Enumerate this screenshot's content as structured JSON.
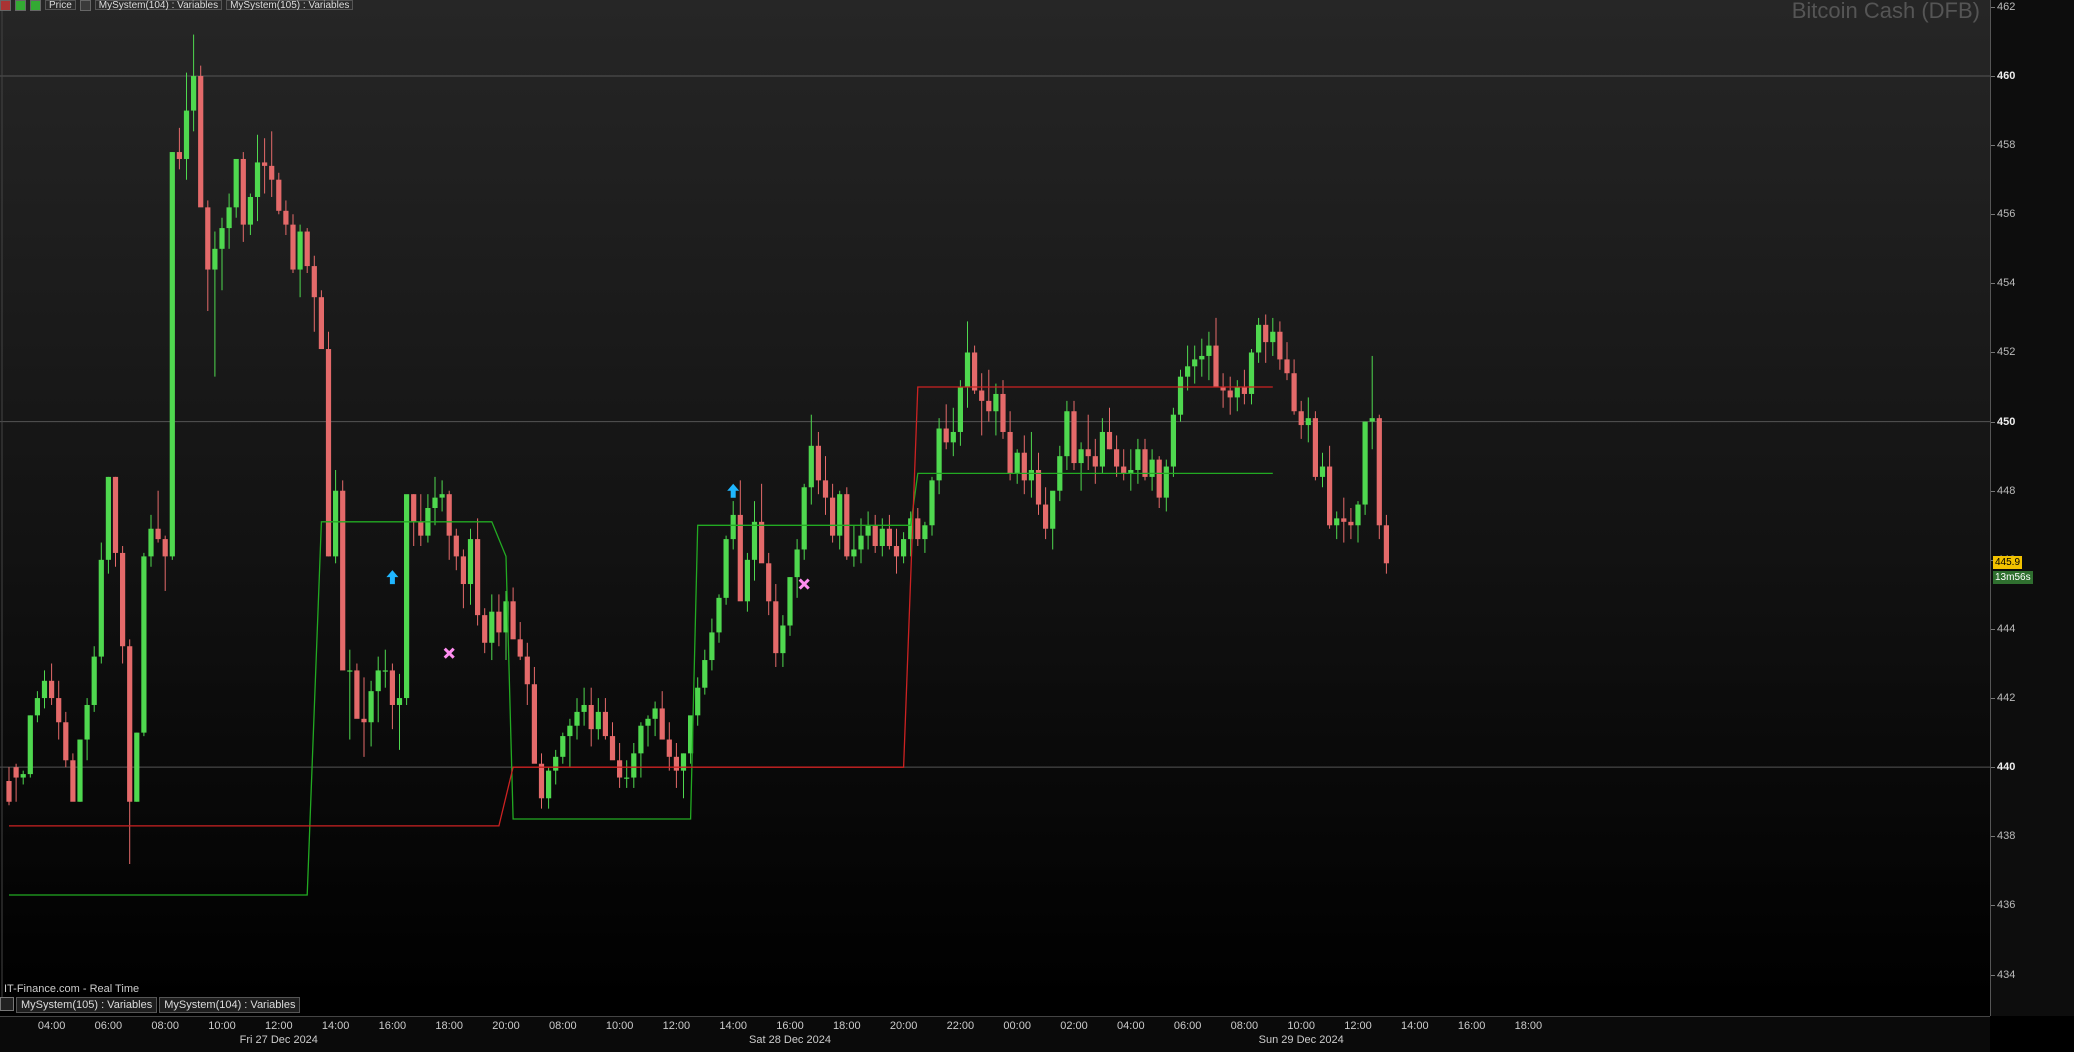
{
  "toolbar": {
    "price_label": "Price",
    "indicator_1": "MySystem(104) : Variables",
    "indicator_2": "MySystem(105) : Variables"
  },
  "watermark": "Bitcoin Cash (DFB)",
  "source": "IT-Finance.com - Real Time",
  "panels": [
    "MySystem(105) : Variables",
    "MySystem(104) : Variables"
  ],
  "badges": {
    "last_price": "445.9",
    "timer": "13m56s"
  },
  "colors": {
    "up": "#4fd84f",
    "down": "#e46a6a",
    "support": "#22aa22",
    "resistance": "#cc2222",
    "buy_arrow": "#1fb6ff",
    "exit_mark": "#ff8ef0"
  },
  "chart_data": {
    "type": "candlestick",
    "title": "Bitcoin Cash (DFB)",
    "ylim": [
      432.8,
      462.2
    ],
    "y_ticks": [
      462,
      460,
      458,
      456,
      454,
      452,
      450,
      448,
      446,
      444,
      442,
      440,
      438,
      436,
      434
    ],
    "major_y": [
      460,
      450,
      440
    ],
    "x_ticks": [
      {
        "label": "04:00",
        "i": 6
      },
      {
        "label": "06:00",
        "i": 14
      },
      {
        "label": "08:00",
        "i": 22
      },
      {
        "label": "10:00",
        "i": 30
      },
      {
        "label": "12:00",
        "i": 38
      },
      {
        "label": "14:00",
        "i": 46
      },
      {
        "label": "16:00",
        "i": 54
      },
      {
        "label": "18:00",
        "i": 62
      },
      {
        "label": "20:00",
        "i": 70
      },
      {
        "label": "08:00",
        "i": 78
      },
      {
        "label": "10:00",
        "i": 86
      },
      {
        "label": "12:00",
        "i": 94
      },
      {
        "label": "14:00",
        "i": 102
      },
      {
        "label": "16:00",
        "i": 110
      },
      {
        "label": "18:00",
        "i": 118
      },
      {
        "label": "20:00",
        "i": 126
      },
      {
        "label": "22:00",
        "i": 134
      },
      {
        "label": "00:00",
        "i": 142
      },
      {
        "label": "02:00",
        "i": 150
      },
      {
        "label": "04:00",
        "i": 158
      },
      {
        "label": "06:00",
        "i": 166
      },
      {
        "label": "08:00",
        "i": 174
      },
      {
        "label": "10:00",
        "i": 182
      },
      {
        "label": "12:00",
        "i": 190
      },
      {
        "label": "14:00",
        "i": 198
      },
      {
        "label": "16:00",
        "i": 206
      },
      {
        "label": "18:00",
        "i": 214
      }
    ],
    "date_labels": [
      {
        "label": "Fri 27 Dec 2024",
        "i": 38
      },
      {
        "label": "Sat 28 Dec 2024",
        "i": 110
      },
      {
        "label": "Sun 29 Dec 2024",
        "i": 182
      }
    ],
    "candles": [
      [
        439.6,
        440.0,
        438.9,
        439.0
      ],
      [
        440.0,
        440.1,
        439.0,
        439.7
      ],
      [
        439.7,
        439.9,
        439.5,
        439.8
      ],
      [
        439.8,
        441.5,
        439.7,
        441.5
      ],
      [
        441.5,
        442.2,
        441.3,
        442.0
      ],
      [
        442.0,
        442.8,
        441.7,
        442.5
      ],
      [
        442.5,
        443.0,
        441.8,
        442.0
      ],
      [
        442.0,
        442.5,
        440.8,
        441.3
      ],
      [
        441.3,
        441.6,
        440.0,
        440.2
      ],
      [
        440.2,
        440.4,
        439.1,
        439.0
      ],
      [
        439.0,
        440.8,
        439.0,
        440.8
      ],
      [
        440.8,
        442.0,
        440.2,
        441.8
      ],
      [
        441.8,
        443.5,
        441.6,
        443.2
      ],
      [
        443.2,
        446.5,
        443.0,
        446.0
      ],
      [
        446.0,
        448.4,
        445.6,
        448.4
      ],
      [
        448.4,
        448.4,
        445.8,
        446.2
      ],
      [
        446.2,
        446.4,
        443.0,
        443.5
      ],
      [
        443.5,
        443.7,
        437.2,
        439.0
      ],
      [
        439.0,
        441.0,
        439.0,
        441.0
      ],
      [
        441.0,
        446.2,
        440.9,
        446.1
      ],
      [
        446.1,
        447.3,
        445.8,
        446.9
      ],
      [
        446.9,
        448.0,
        446.5,
        446.6
      ],
      [
        446.6,
        446.7,
        445.1,
        446.1
      ],
      [
        446.1,
        457.8,
        446.0,
        457.8
      ],
      [
        457.8,
        458.5,
        457.3,
        457.6
      ],
      [
        457.6,
        460.1,
        457.0,
        459.0
      ],
      [
        459.0,
        461.2,
        458.4,
        460.0
      ],
      [
        460.0,
        460.3,
        456.3,
        456.2
      ],
      [
        456.2,
        456.4,
        453.2,
        454.4
      ],
      [
        454.4,
        455.5,
        451.3,
        455.0
      ],
      [
        455.0,
        455.9,
        453.8,
        455.6
      ],
      [
        455.6,
        456.6,
        455.0,
        456.2
      ],
      [
        456.2,
        457.3,
        455.9,
        457.6
      ],
      [
        457.6,
        457.8,
        455.2,
        455.7
      ],
      [
        455.7,
        456.6,
        455.4,
        456.5
      ],
      [
        456.5,
        458.3,
        455.8,
        457.5
      ],
      [
        457.5,
        458.2,
        456.6,
        457.4
      ],
      [
        457.4,
        458.4,
        456.5,
        457.0
      ],
      [
        457.0,
        457.2,
        456.0,
        456.1
      ],
      [
        456.1,
        456.4,
        455.4,
        455.7
      ],
      [
        455.7,
        456.0,
        454.3,
        454.4
      ],
      [
        454.4,
        455.7,
        453.6,
        455.5
      ],
      [
        455.5,
        455.6,
        454.3,
        454.5
      ],
      [
        454.5,
        454.8,
        452.6,
        453.6
      ],
      [
        453.6,
        453.8,
        452.3,
        452.1
      ],
      [
        452.1,
        452.6,
        446.1,
        446.1
      ],
      [
        446.1,
        448.6,
        445.9,
        448.0
      ],
      [
        448.0,
        448.3,
        443.7,
        442.8
      ],
      [
        442.8,
        443.4,
        440.8,
        442.8
      ],
      [
        442.8,
        443.0,
        441.5,
        441.4
      ],
      [
        441.4,
        442.6,
        440.3,
        441.3
      ],
      [
        441.3,
        442.5,
        440.6,
        442.2
      ],
      [
        442.2,
        443.2,
        441.3,
        442.8
      ],
      [
        442.8,
        443.4,
        442.3,
        442.8
      ],
      [
        442.8,
        443.0,
        441.1,
        441.8
      ],
      [
        441.8,
        442.7,
        440.5,
        442.0
      ],
      [
        442.0,
        447.2,
        441.8,
        447.9
      ],
      [
        447.9,
        447.9,
        446.4,
        447.1
      ],
      [
        447.1,
        447.9,
        446.4,
        446.7
      ],
      [
        446.7,
        447.9,
        446.5,
        447.5
      ],
      [
        447.5,
        448.4,
        447.0,
        447.8
      ],
      [
        447.8,
        448.3,
        447.4,
        447.9
      ],
      [
        447.9,
        448.0,
        446.0,
        446.7
      ],
      [
        446.7,
        446.9,
        445.7,
        446.1
      ],
      [
        446.1,
        446.3,
        444.6,
        445.3
      ],
      [
        445.3,
        446.9,
        444.7,
        446.6
      ],
      [
        446.6,
        447.2,
        444.1,
        444.4
      ],
      [
        444.4,
        444.6,
        443.3,
        443.6
      ],
      [
        443.6,
        445.0,
        443.1,
        444.5
      ],
      [
        444.5,
        445.0,
        443.5,
        443.9
      ],
      [
        443.9,
        445.1,
        443.1,
        444.8
      ],
      [
        444.8,
        445.2,
        443.9,
        443.7
      ],
      [
        443.7,
        444.2,
        443.1,
        443.2
      ],
      [
        443.2,
        443.6,
        441.8,
        442.4
      ],
      [
        442.4,
        442.9,
        440.2,
        440.1
      ],
      [
        440.1,
        440.4,
        438.8,
        439.1
      ],
      [
        439.1,
        440.0,
        438.8,
        439.9
      ],
      [
        439.9,
        440.5,
        439.5,
        440.3
      ],
      [
        440.3,
        441.0,
        440.1,
        440.9
      ],
      [
        440.9,
        441.4,
        440.0,
        441.2
      ],
      [
        441.2,
        442.0,
        440.8,
        441.6
      ],
      [
        441.6,
        442.3,
        441.2,
        441.8
      ],
      [
        441.8,
        442.3,
        440.6,
        441.1
      ],
      [
        441.1,
        442.0,
        440.8,
        441.6
      ],
      [
        441.6,
        442.0,
        440.8,
        440.9
      ],
      [
        440.9,
        441.3,
        440.6,
        440.2
      ],
      [
        440.2,
        440.7,
        439.4,
        439.7
      ],
      [
        439.7,
        440.2,
        439.4,
        439.7
      ],
      [
        439.7,
        440.7,
        439.4,
        440.4
      ],
      [
        440.4,
        441.3,
        439.7,
        441.2
      ],
      [
        441.2,
        441.5,
        440.6,
        441.4
      ],
      [
        441.4,
        441.9,
        440.9,
        441.7
      ],
      [
        441.7,
        442.2,
        440.9,
        440.8
      ],
      [
        440.8,
        441.3,
        439.9,
        440.3
      ],
      [
        440.3,
        440.7,
        439.4,
        439.9
      ],
      [
        439.9,
        440.4,
        439.1,
        440.4
      ],
      [
        440.4,
        441.3,
        440.1,
        441.5
      ],
      [
        441.5,
        442.6,
        441.2,
        442.3
      ],
      [
        442.3,
        443.4,
        442.1,
        443.1
      ],
      [
        443.1,
        444.3,
        442.8,
        443.9
      ],
      [
        443.9,
        445.0,
        443.6,
        444.9
      ],
      [
        444.9,
        446.7,
        444.7,
        446.6
      ],
      [
        446.6,
        447.7,
        446.3,
        447.3
      ],
      [
        447.3,
        448.3,
        444.9,
        444.8
      ],
      [
        444.8,
        446.2,
        444.5,
        446.0
      ],
      [
        446.0,
        447.7,
        445.4,
        447.1
      ],
      [
        447.1,
        448.2,
        446.6,
        445.9
      ],
      [
        445.9,
        446.2,
        444.4,
        444.8
      ],
      [
        444.8,
        445.3,
        442.9,
        443.3
      ],
      [
        443.3,
        444.4,
        442.9,
        444.1
      ],
      [
        444.1,
        445.5,
        443.8,
        445.5
      ],
      [
        445.5,
        446.6,
        444.9,
        446.3
      ],
      [
        446.3,
        448.2,
        446.0,
        448.1
      ],
      [
        448.1,
        450.2,
        447.6,
        449.3
      ],
      [
        449.3,
        449.7,
        447.9,
        448.3
      ],
      [
        448.3,
        449.0,
        447.3,
        447.8
      ],
      [
        447.8,
        448.2,
        446.5,
        446.7
      ],
      [
        446.7,
        448.0,
        446.3,
        447.9
      ],
      [
        447.9,
        448.1,
        446.0,
        446.1
      ],
      [
        446.1,
        447.0,
        445.8,
        446.3
      ],
      [
        446.3,
        447.2,
        445.9,
        446.7
      ],
      [
        446.7,
        447.4,
        446.3,
        447.0
      ],
      [
        447.0,
        447.3,
        446.2,
        446.4
      ],
      [
        446.4,
        447.2,
        446.1,
        446.9
      ],
      [
        446.9,
        447.3,
        446.3,
        446.4
      ],
      [
        446.4,
        446.9,
        445.6,
        446.1
      ],
      [
        446.1,
        446.8,
        445.9,
        446.6
      ],
      [
        446.6,
        447.4,
        446.1,
        447.2
      ],
      [
        447.2,
        447.5,
        446.4,
        446.6
      ],
      [
        446.6,
        447.1,
        446.2,
        447.0
      ],
      [
        447.0,
        448.4,
        446.7,
        448.3
      ],
      [
        448.3,
        450.1,
        447.9,
        449.8
      ],
      [
        449.8,
        450.5,
        449.2,
        449.4
      ],
      [
        449.4,
        450.4,
        449.0,
        449.7
      ],
      [
        449.7,
        451.2,
        449.3,
        451.0
      ],
      [
        451.0,
        452.9,
        450.4,
        452.0
      ],
      [
        452.0,
        452.2,
        450.8,
        450.9
      ],
      [
        450.9,
        451.4,
        449.6,
        450.6
      ],
      [
        450.6,
        451.5,
        450.0,
        450.3
      ],
      [
        450.3,
        451.1,
        449.6,
        450.8
      ],
      [
        450.8,
        451.2,
        449.5,
        449.7
      ],
      [
        449.7,
        450.3,
        448.3,
        448.5
      ],
      [
        448.5,
        449.2,
        448.2,
        449.1
      ],
      [
        449.1,
        449.6,
        447.9,
        448.3
      ],
      [
        448.3,
        449.7,
        447.8,
        448.6
      ],
      [
        448.6,
        449.1,
        447.3,
        447.6
      ],
      [
        447.6,
        448.1,
        446.6,
        446.9
      ],
      [
        446.9,
        447.5,
        446.3,
        448.0
      ],
      [
        448.0,
        449.3,
        447.7,
        449.0
      ],
      [
        449.0,
        450.6,
        448.6,
        450.3
      ],
      [
        450.3,
        450.6,
        448.6,
        448.8
      ],
      [
        448.8,
        449.4,
        448.0,
        449.2
      ],
      [
        449.2,
        450.2,
        448.6,
        449.0
      ],
      [
        449.0,
        449.5,
        448.2,
        448.7
      ],
      [
        448.7,
        450.1,
        448.5,
        449.7
      ],
      [
        449.7,
        450.4,
        449.2,
        449.2
      ],
      [
        449.2,
        449.6,
        448.4,
        448.7
      ],
      [
        448.7,
        449.2,
        448.3,
        448.5
      ],
      [
        448.5,
        449.2,
        448.0,
        448.6
      ],
      [
        448.6,
        449.5,
        448.2,
        449.2
      ],
      [
        449.2,
        449.5,
        448.3,
        448.4
      ],
      [
        448.4,
        449.2,
        448.0,
        448.9
      ],
      [
        448.9,
        449.0,
        447.5,
        447.8
      ],
      [
        447.8,
        448.9,
        447.4,
        448.7
      ],
      [
        448.7,
        450.4,
        448.4,
        450.2
      ],
      [
        450.2,
        451.5,
        450.0,
        451.3
      ],
      [
        451.3,
        452.2,
        450.9,
        451.6
      ],
      [
        451.6,
        452.2,
        451.1,
        451.8
      ],
      [
        451.8,
        452.4,
        451.3,
        451.9
      ],
      [
        451.9,
        452.6,
        451.2,
        452.2
      ],
      [
        452.2,
        453.0,
        451.5,
        451.0
      ],
      [
        451.0,
        451.4,
        450.4,
        450.9
      ],
      [
        450.9,
        451.3,
        450.2,
        450.7
      ],
      [
        450.7,
        451.2,
        450.3,
        451.0
      ],
      [
        451.0,
        451.5,
        450.5,
        450.8
      ],
      [
        450.8,
        452.1,
        450.5,
        452.0
      ],
      [
        452.0,
        453.0,
        451.7,
        452.8
      ],
      [
        452.8,
        453.1,
        451.7,
        452.3
      ],
      [
        452.3,
        453.0,
        451.9,
        452.6
      ],
      [
        452.6,
        452.9,
        451.5,
        451.8
      ],
      [
        451.8,
        452.3,
        451.2,
        451.4
      ],
      [
        451.4,
        451.8,
        450.2,
        450.3
      ],
      [
        450.3,
        450.6,
        449.5,
        449.9
      ],
      [
        449.9,
        450.7,
        449.4,
        450.1
      ],
      [
        450.1,
        450.3,
        448.3,
        448.4
      ],
      [
        448.4,
        449.1,
        448.1,
        448.7
      ],
      [
        448.7,
        449.3,
        446.9,
        447.0
      ],
      [
        447.0,
        447.4,
        446.6,
        447.2
      ],
      [
        447.2,
        447.8,
        446.5,
        447.1
      ],
      [
        447.1,
        447.5,
        446.6,
        447.0
      ],
      [
        447.0,
        447.7,
        446.5,
        447.6
      ],
      [
        447.6,
        450.0,
        447.3,
        450.0
      ],
      [
        450.0,
        451.9,
        449.2,
        450.1
      ],
      [
        450.1,
        450.2,
        446.6,
        447.0
      ],
      [
        447.0,
        447.3,
        445.6,
        445.9
      ]
    ],
    "support_line": [
      [
        0,
        436.3
      ],
      [
        42,
        436.3
      ],
      [
        44,
        447.1
      ],
      [
        68,
        447.1
      ],
      [
        70,
        446.1
      ],
      [
        71,
        438.5
      ],
      [
        96,
        438.5
      ],
      [
        97,
        447.0
      ],
      [
        127,
        447.0
      ],
      [
        128,
        448.5
      ],
      [
        178,
        448.5
      ]
    ],
    "resistance_line": [
      [
        0,
        438.3
      ],
      [
        69,
        438.3
      ],
      [
        71,
        440.0
      ],
      [
        126,
        440.0
      ],
      [
        128,
        451.0
      ],
      [
        178,
        451.0
      ]
    ],
    "buy_arrows": [
      [
        54,
        445.5
      ],
      [
        102,
        448.0
      ]
    ],
    "exit_marks": [
      [
        62,
        443.3
      ],
      [
        112,
        445.3
      ]
    ]
  }
}
